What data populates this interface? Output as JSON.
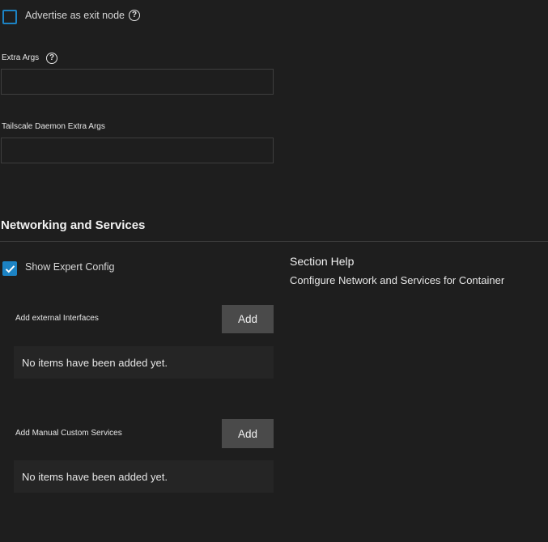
{
  "exit_node": {
    "label": "Advertise as exit node",
    "checked": false,
    "help_icon": "question-circle-icon"
  },
  "extra_args": {
    "label": "Extra Args",
    "value": "",
    "help_icon": "question-circle-icon"
  },
  "daemon_args": {
    "label": "Tailscale Daemon Extra Args",
    "value": ""
  },
  "networking": {
    "title": "Networking and Services",
    "expert_config": {
      "label": "Show Expert Config",
      "checked": true,
      "icon": "checkmark-icon"
    },
    "external_interfaces": {
      "label": "Add external Interfaces",
      "add_label": "Add",
      "empty_text": "No items have been added yet."
    },
    "custom_services": {
      "label": "Add Manual Custom Services",
      "add_label": "Add",
      "empty_text": "No items have been added yet."
    }
  },
  "section_help": {
    "title": "Section Help",
    "text": "Configure Network and Services for Container"
  },
  "colors": {
    "background": "#1e1e1e",
    "accent": "#1c83c4",
    "button": "#4a4a4a",
    "empty_box": "#252525"
  }
}
